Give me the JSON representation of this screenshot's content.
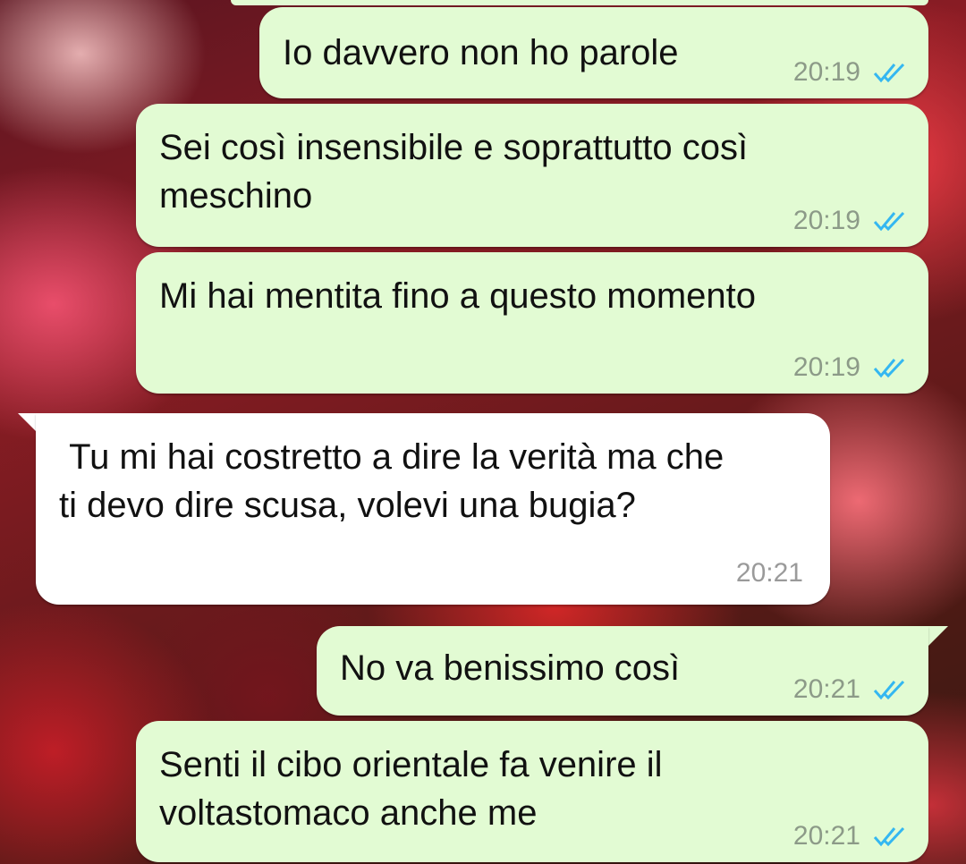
{
  "colors": {
    "outgoing_bubble": "#e2fbd3",
    "incoming_bubble": "#ffffff",
    "read_ticks": "#34b7f1",
    "timestamp": "#8c9a88"
  },
  "messages": [
    {
      "direction": "out",
      "text": "Io davvero non ho parole",
      "time": "20:19",
      "status_icon": "double-check-read-icon"
    },
    {
      "direction": "out",
      "text": "Sei così insensibile e soprattutto così meschino",
      "time": "20:19",
      "status_icon": "double-check-read-icon"
    },
    {
      "direction": "out",
      "text": "Mi hai mentita fino a questo momento",
      "time": "20:19",
      "status_icon": "double-check-read-icon"
    },
    {
      "direction": "in",
      "text": " Tu mi hai costretto a dire la verità ma che ti devo dire scusa, volevi una bugia?",
      "time": "20:21"
    },
    {
      "direction": "out",
      "text": "No va benissimo così",
      "time": "20:21",
      "status_icon": "double-check-read-icon"
    },
    {
      "direction": "out",
      "text": "Senti il cibo orientale fa venire il voltastomaco anche me",
      "time": "20:21",
      "status_icon": "double-check-read-icon"
    }
  ]
}
